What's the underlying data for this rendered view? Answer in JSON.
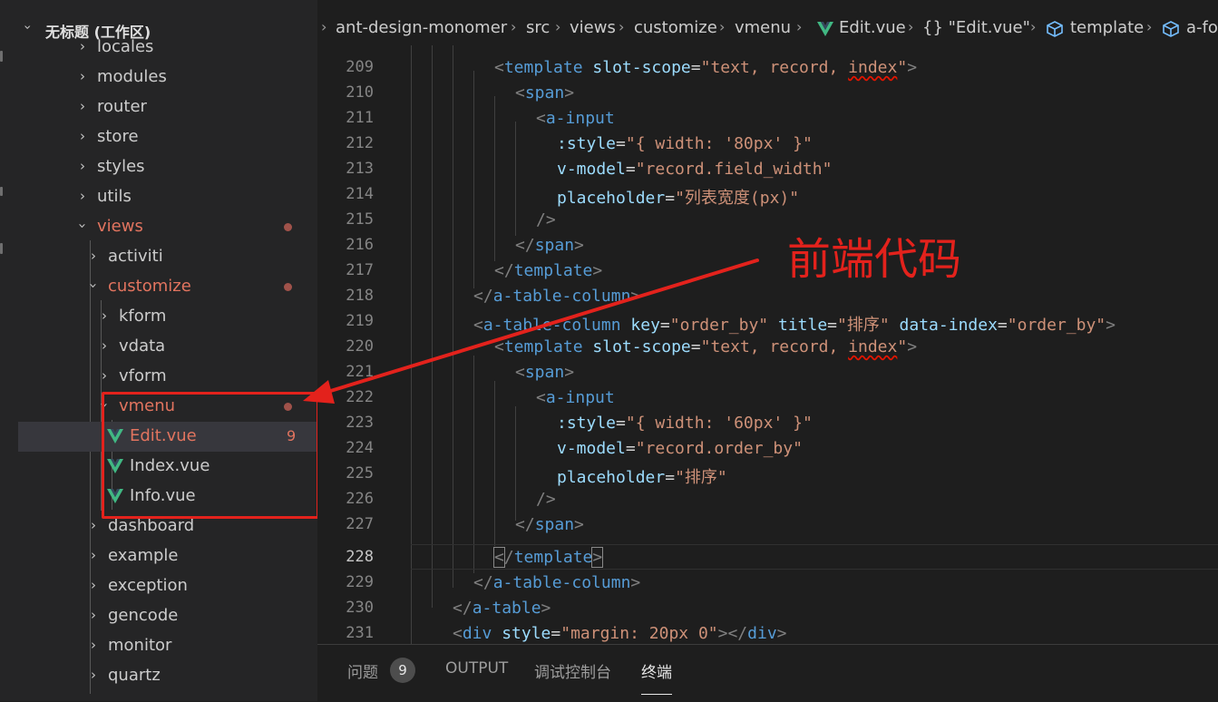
{
  "explorer": {
    "workspace_title": "无标题 (工作区)",
    "items": [
      {
        "label": "locales"
      },
      {
        "label": "modules"
      },
      {
        "label": "router"
      },
      {
        "label": "store"
      },
      {
        "label": "styles"
      },
      {
        "label": "utils"
      },
      {
        "label": "views"
      },
      {
        "label": "activiti"
      },
      {
        "label": "customize"
      },
      {
        "label": "kform"
      },
      {
        "label": "vdata"
      },
      {
        "label": "vform"
      },
      {
        "label": "vmenu"
      },
      {
        "label": "Edit.vue",
        "badge": "9"
      },
      {
        "label": "Index.vue"
      },
      {
        "label": "Info.vue"
      },
      {
        "label": "dashboard"
      },
      {
        "label": "example"
      },
      {
        "label": "exception"
      },
      {
        "label": "gencode"
      },
      {
        "label": "monitor"
      },
      {
        "label": "quartz"
      }
    ]
  },
  "breadcrumb": {
    "items": [
      "ant-design-monomer",
      "src",
      "views",
      "customize",
      "vmenu",
      "Edit.vue",
      "{} \"Edit.vue\"",
      "template",
      "a-fo"
    ]
  },
  "editor": {
    "current_line": "228",
    "lines": [
      {
        "n": "209"
      },
      {
        "n": "210"
      },
      {
        "n": "211"
      },
      {
        "n": "212"
      },
      {
        "n": "213"
      },
      {
        "n": "214"
      },
      {
        "n": "215"
      },
      {
        "n": "216"
      },
      {
        "n": "217"
      },
      {
        "n": "218"
      },
      {
        "n": "219"
      },
      {
        "n": "220"
      },
      {
        "n": "221"
      },
      {
        "n": "222"
      },
      {
        "n": "223"
      },
      {
        "n": "224"
      },
      {
        "n": "225"
      },
      {
        "n": "226"
      },
      {
        "n": "227"
      },
      {
        "n": "228"
      },
      {
        "n": "229"
      },
      {
        "n": "230"
      },
      {
        "n": "231"
      }
    ],
    "code": {
      "l209": {
        "tag": "template",
        "a1": "slot-scope",
        "v1": "\"text, record, ",
        "v1b": "index",
        "v1c": "\""
      },
      "l210": {
        "tag": "span"
      },
      "l211": {
        "tag": "a-input"
      },
      "l212": {
        "a1": ":style",
        "v1": "\"{ width: '80px' }\""
      },
      "l213": {
        "a1": "v-model",
        "v1": "\"record.field_width\""
      },
      "l214": {
        "a1": "placeholder",
        "v1": "\"列表宽度(px)\""
      },
      "l215": {
        "end": "/>"
      },
      "l216": {
        "tag": "span"
      },
      "l217": {
        "tag": "template"
      },
      "l218": {
        "tag": "a-table-column"
      },
      "l219": {
        "tag": "a-table-column",
        "a1": "key",
        "v1": "\"order_by\"",
        "a2": "title",
        "v2": "\"排序\"",
        "a3": "data-index",
        "v3": "\"order_by\""
      },
      "l220": {
        "tag": "template",
        "a1": "slot-scope",
        "v1": "\"text, record, ",
        "v1b": "index",
        "v1c": "\""
      },
      "l221": {
        "tag": "span"
      },
      "l222": {
        "tag": "a-input"
      },
      "l223": {
        "a1": ":style",
        "v1": "\"{ width: '60px' }\""
      },
      "l224": {
        "a1": "v-model",
        "v1": "\"record.order_by\""
      },
      "l225": {
        "a1": "placeholder",
        "v1": "\"排序\""
      },
      "l226": {
        "end": "/>"
      },
      "l227": {
        "tag": "span"
      },
      "l228": {
        "tag": "template"
      },
      "l229": {
        "tag": "a-table-column"
      },
      "l230": {
        "tag": "a-table"
      },
      "l231": {
        "tag": "div",
        "a1": "style",
        "v1": "\"margin: 20px 0\"",
        "ctag": "div"
      }
    }
  },
  "annotation": {
    "text": "前端代码",
    "color": "#e3221c"
  },
  "panel": {
    "tabs": [
      {
        "label": "问题",
        "badge": "9"
      },
      {
        "label": "OUTPUT"
      },
      {
        "label": "调试控制台"
      },
      {
        "label": "终端",
        "active": true
      }
    ]
  },
  "colors": {
    "modified": "#e2745f",
    "vue": "#41b883",
    "tag": "#569cd6",
    "attr": "#9cdcfe",
    "string": "#ce9178"
  }
}
